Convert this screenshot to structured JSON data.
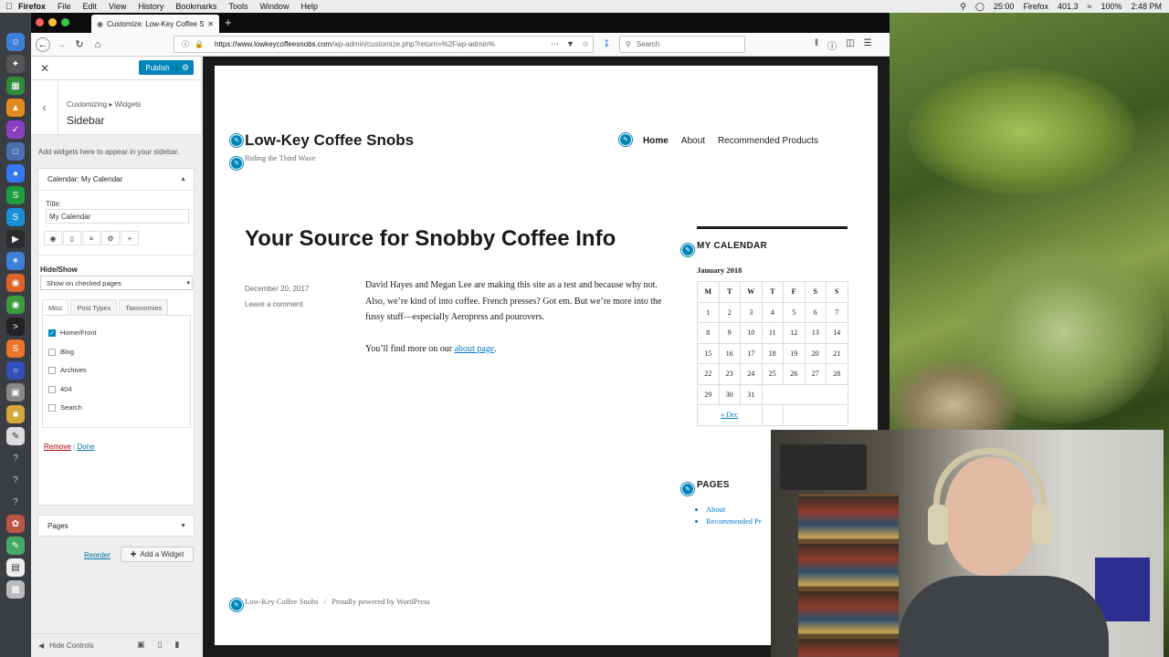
{
  "menubar": {
    "app": "Firefox",
    "items": [
      "File",
      "Edit",
      "View",
      "History",
      "Bookmarks",
      "Tools",
      "Window",
      "Help"
    ],
    "right": {
      "time1": "25:00",
      "app_status": "Firefox",
      "net": "401.3",
      "percent": "100%",
      "clock": "2:48 PM"
    }
  },
  "browser": {
    "tab_title": "Customize: Low-Key Coffee Sn",
    "url_host": "https://www.lowkeycoffeesnobs.com",
    "url_path": "/wp-admin/customize.php?return=%2Fwp-admin%",
    "search_placeholder": "Search"
  },
  "customizer": {
    "publish_label": "Publish",
    "breadcrumb": "Customizing ▸ Widgets",
    "section_title": "Sidebar",
    "description": "Add widgets here to appear in your sidebar.",
    "widget": {
      "header": "Calendar: My Calendar",
      "title_label": "Title:",
      "title_value": "My Calendar",
      "hide_show_label": "Hide/Show",
      "hide_show_value": "Show on checked pages",
      "tabs": [
        "Misc",
        "Post Types",
        "Taxonomies"
      ],
      "options": [
        {
          "label": "Home/Front",
          "checked": true
        },
        {
          "label": "Blog",
          "checked": false
        },
        {
          "label": "Archives",
          "checked": false
        },
        {
          "label": "404",
          "checked": false
        },
        {
          "label": "Search",
          "checked": false
        }
      ],
      "remove_label": "Remove",
      "separator": "|",
      "done_label": "Done"
    },
    "pages_widget": "Pages",
    "reorder_label": "Reorder",
    "add_widget_label": "Add a Widget",
    "hide_controls_label": "Hide Controls"
  },
  "site": {
    "title": "Low-Key Coffee Snobs",
    "tagline": "Riding the Third Wave",
    "nav": [
      "Home",
      "About",
      "Recommended Products"
    ],
    "post_title": "Your Source for Snobby Coffee Info",
    "post_date": "December 20, 2017",
    "post_comment": "Leave a comment",
    "post_para1": "David Hayes and Megan Lee are making this site as a test and because why not. Also, we’re kind of into coffee. French presses? Got em. But we’re more into the fussy stuff—especially Aeropress and pourovers.",
    "post_para2_before": "You’ll find more on our ",
    "post_para2_link": "about page",
    "post_para2_after": ".",
    "calendar_heading": "MY CALENDAR",
    "calendar_caption": "January 2018",
    "calendar_days": [
      "M",
      "T",
      "W",
      "T",
      "F",
      "S",
      "S"
    ],
    "calendar_weeks": [
      [
        "1",
        "2",
        "3",
        "4",
        "5",
        "6",
        "7"
      ],
      [
        "8",
        "9",
        "10",
        "11",
        "12",
        "13",
        "14"
      ],
      [
        "15",
        "16",
        "17",
        "18",
        "19",
        "20",
        "21"
      ],
      [
        "22",
        "23",
        "24",
        "25",
        "26",
        "27",
        "28"
      ],
      [
        "29",
        "30",
        "31",
        "",
        "",
        "",
        ""
      ]
    ],
    "calendar_prev": "« Dec",
    "pages_heading": "PAGES",
    "pages_list": [
      "About",
      "Recommended Pr"
    ],
    "footer_site": "Low-Key Coffee Snobs",
    "footer_sep": "/",
    "footer_powered": "Proudly powered by WordPress"
  },
  "colors": {
    "wp_blue": "#0085ba",
    "link": "#007acc",
    "remove": "#a00"
  }
}
